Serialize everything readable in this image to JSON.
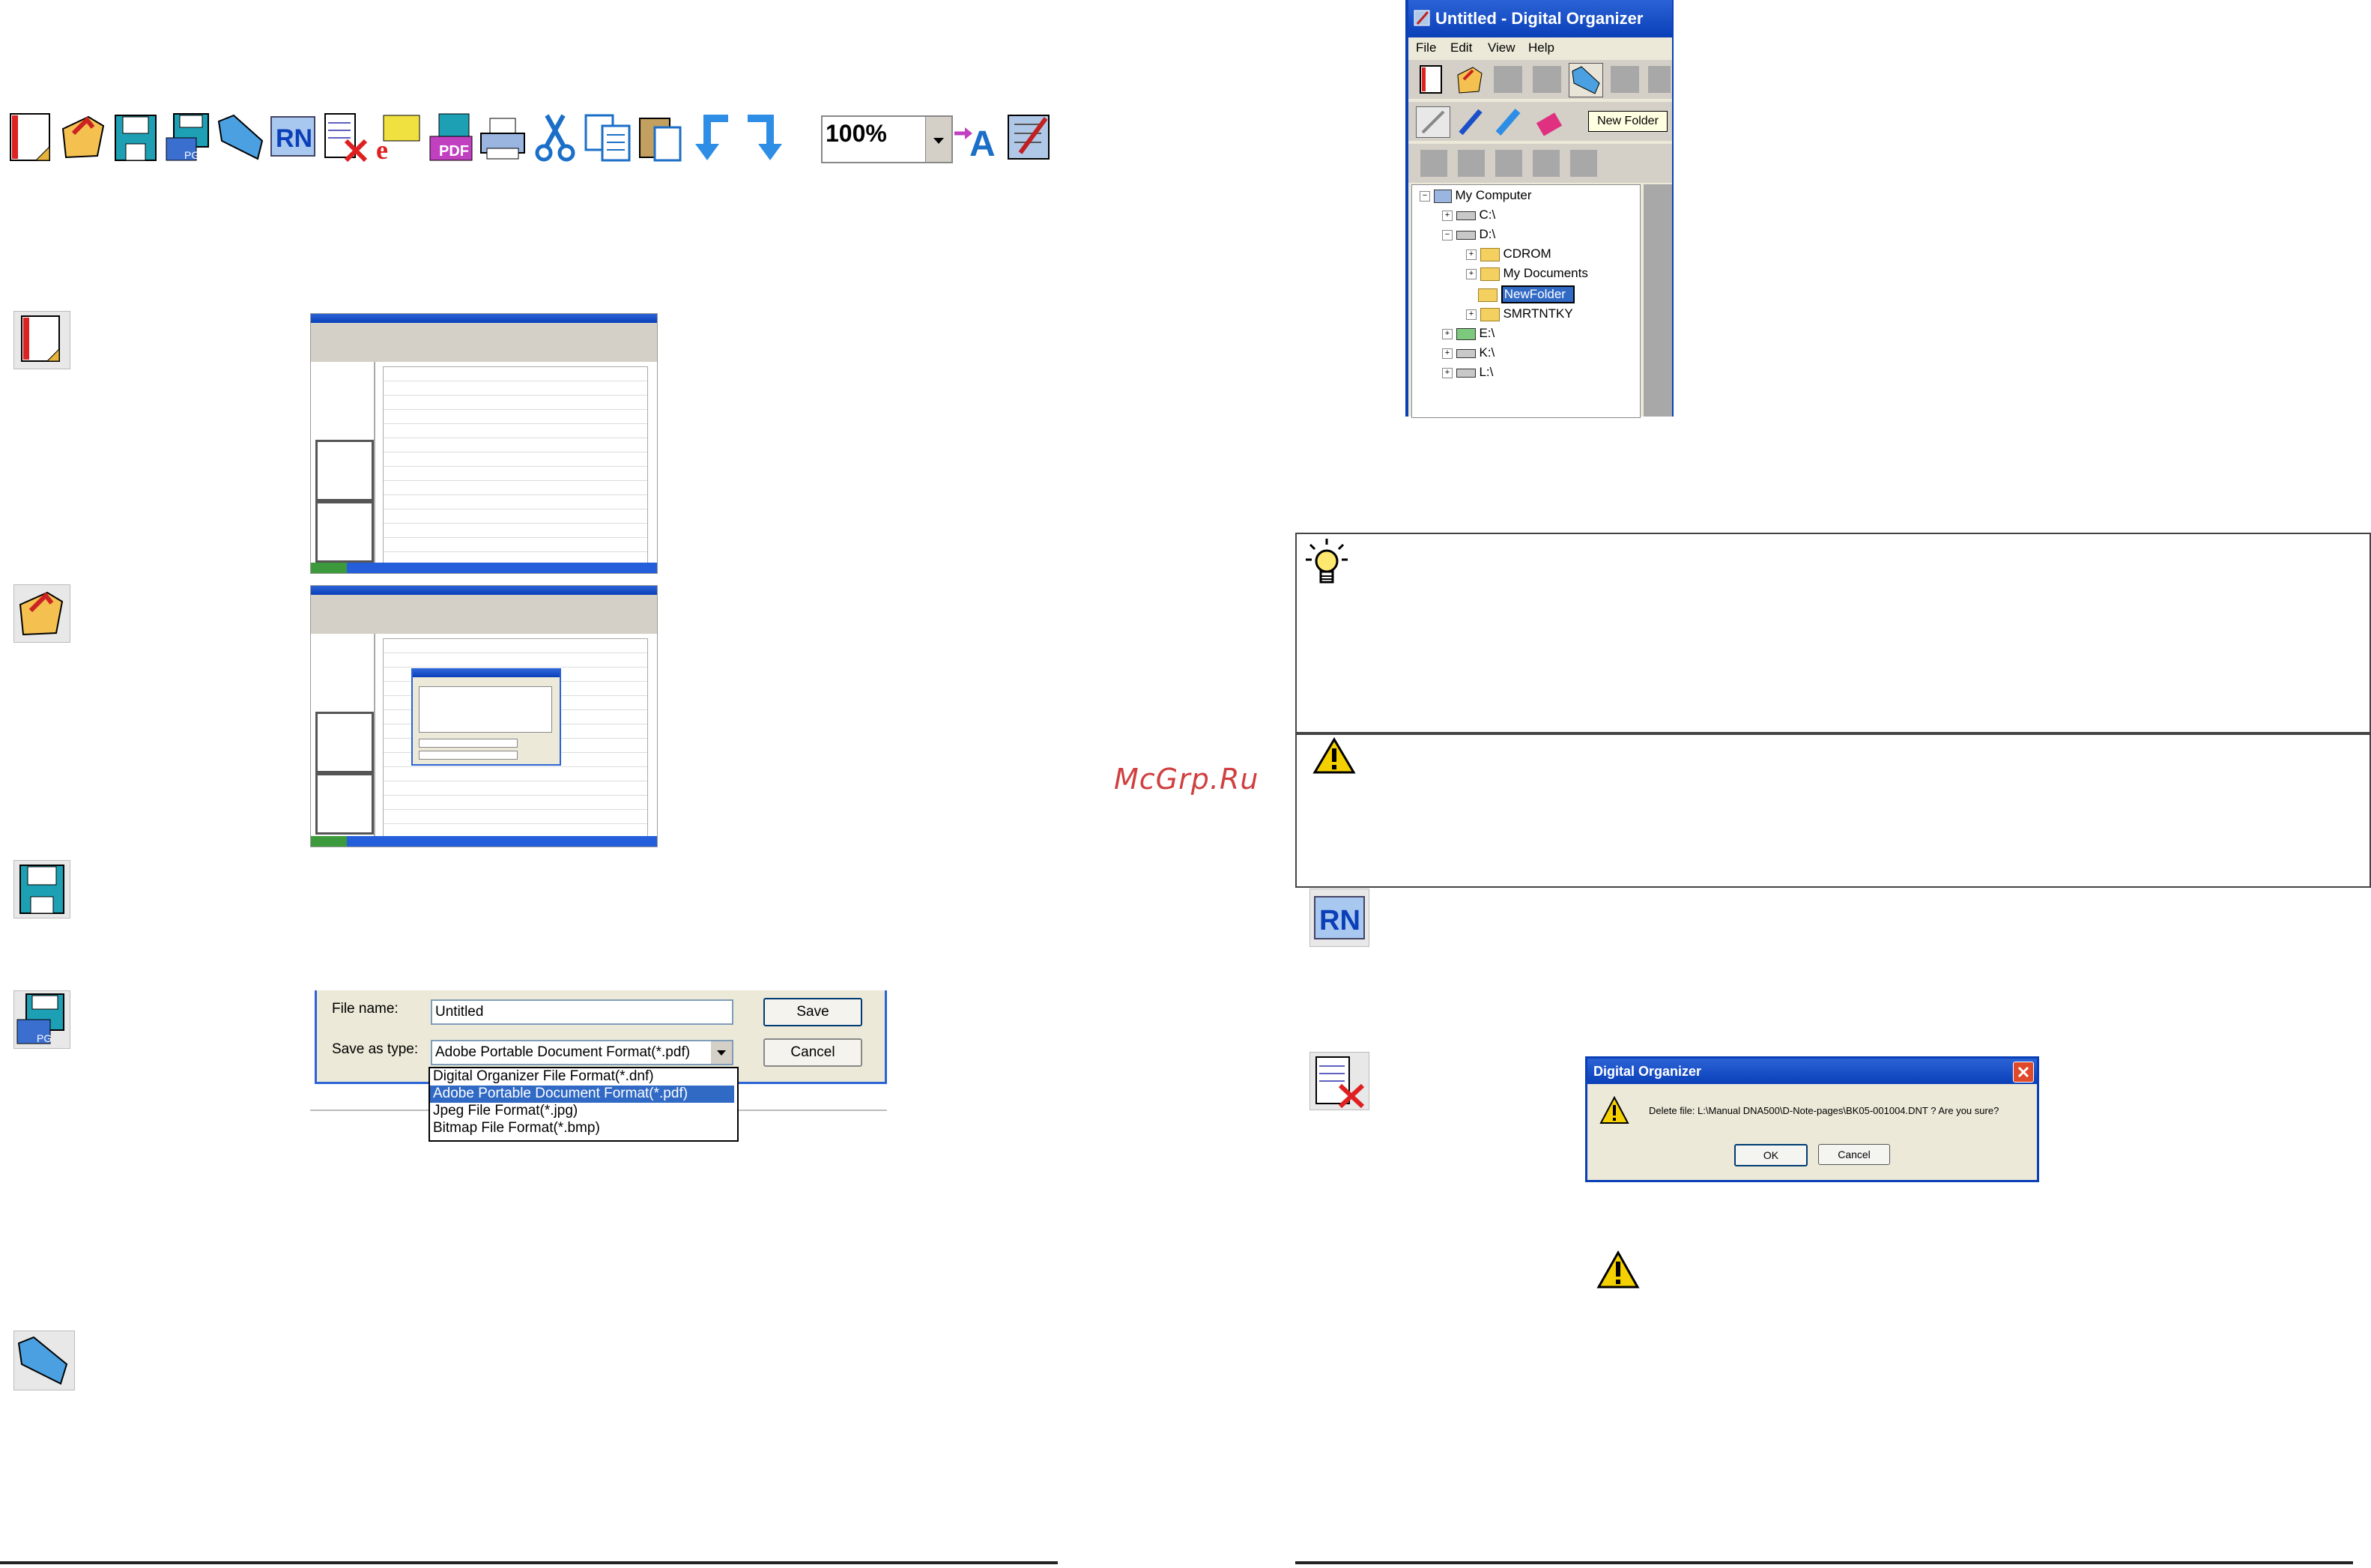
{
  "toolbar": {
    "zoom_value": "100%",
    "icons": [
      "new-page-icon",
      "open-icon",
      "save-icon",
      "save-as-icon",
      "new-folder-icon",
      "rename-icon",
      "delete-icon",
      "email-icon",
      "pdf-icon",
      "print-icon",
      "cut-icon",
      "copy-icon",
      "paste-icon",
      "undo-icon",
      "redo-icon",
      "zoom-select",
      "text-icon",
      "edit-icon"
    ]
  },
  "watermark": "McGrp.Ru",
  "save_dialog": {
    "file_name_label": "File name:",
    "file_name_value": "Untitled",
    "save_as_type_label": "Save as type:",
    "save_as_type_value": "Adobe Portable Document Format(*.pdf)",
    "save_button": "Save",
    "cancel_button": "Cancel",
    "options": [
      "Digital Organizer File Format(*.dnf)",
      "Adobe Portable Document Format(*.pdf)",
      "Jpeg File Format(*.jpg)",
      "Bitmap File Format(*.bmp)"
    ]
  },
  "organizer_window": {
    "title": "Untitled - Digital Organizer",
    "menu": [
      "File",
      "Edit",
      "View",
      "Help"
    ],
    "tooltip": "New Folder",
    "tree": {
      "root": "My Computer",
      "c": "C:\\",
      "d": "D:\\",
      "cdrom": "CDROM",
      "mydocs": "My Documents",
      "newfolder": "NewFolder",
      "smrtntky": "SMRTNTKY",
      "e": "E:\\",
      "k": "K:\\",
      "l": "L:\\"
    }
  },
  "delete_dialog": {
    "title": "Digital Organizer",
    "message": "Delete file: L:\\Manual DNA500\\D-Note-pages\\BK05-001004.DNT ? Are you sure?",
    "ok": "OK",
    "cancel": "Cancel"
  },
  "colors": {
    "xp_blue": "#0a3fb8",
    "select_blue": "#316ac5",
    "warning_yellow": "#f5d000"
  }
}
